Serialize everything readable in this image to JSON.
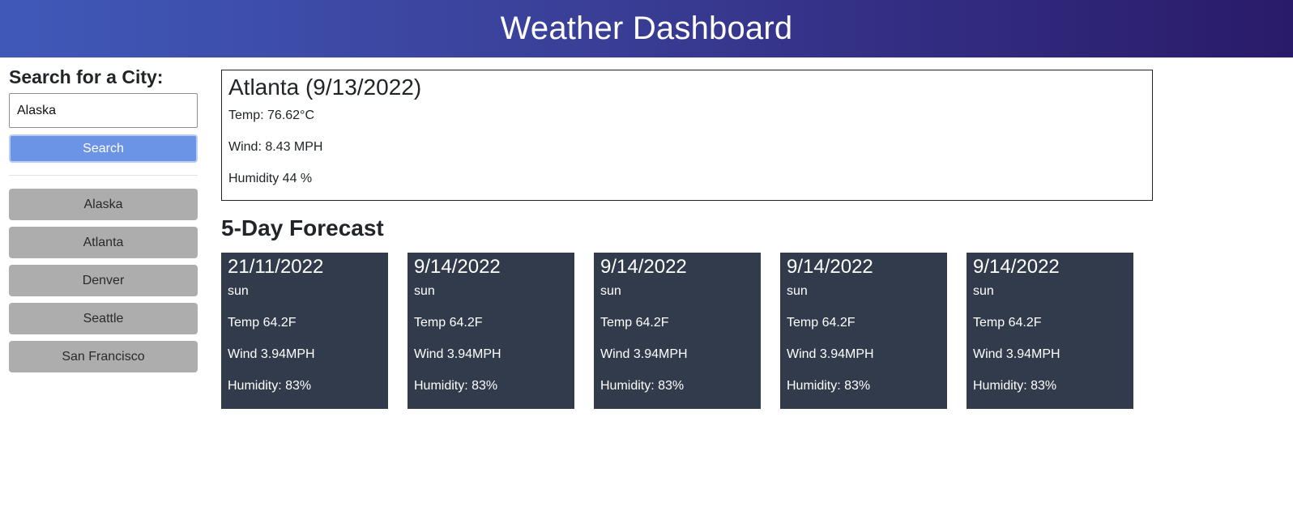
{
  "header": {
    "title": "Weather Dashboard"
  },
  "sidebar": {
    "heading": "Search for a City:",
    "search_value": "Alaska",
    "search_button": "Search",
    "history": [
      "Alaska",
      "Atlanta",
      "Denver",
      "Seattle",
      "San Francisco"
    ]
  },
  "current": {
    "title": "Atlanta (9/13/2022)",
    "temp": "Temp: 76.62°C",
    "wind": "Wind: 8.43 MPH",
    "humidity": "Humidity 44 %"
  },
  "forecast": {
    "heading": "5-Day Forecast",
    "days": [
      {
        "date": "21/11/2022",
        "condition": "sun",
        "temp": "Temp 64.2F",
        "wind": "Wind 3.94MPH",
        "humidity": "Humidity: 83%"
      },
      {
        "date": "9/14/2022",
        "condition": "sun",
        "temp": "Temp 64.2F",
        "wind": "Wind 3.94MPH",
        "humidity": "Humidity: 83%"
      },
      {
        "date": "9/14/2022",
        "condition": "sun",
        "temp": "Temp 64.2F",
        "wind": "Wind 3.94MPH",
        "humidity": "Humidity: 83%"
      },
      {
        "date": "9/14/2022",
        "condition": "sun",
        "temp": "Temp 64.2F",
        "wind": "Wind 3.94MPH",
        "humidity": "Humidity: 83%"
      },
      {
        "date": "9/14/2022",
        "condition": "sun",
        "temp": "Temp 64.2F",
        "wind": "Wind 3.94MPH",
        "humidity": "Humidity: 83%"
      }
    ]
  },
  "colors": {
    "header_gradient_start": "#4059b9",
    "header_gradient_end": "#2a1a6a",
    "search_button": "#6b93e6",
    "history_button": "#adadad",
    "forecast_card": "#313b4b"
  }
}
